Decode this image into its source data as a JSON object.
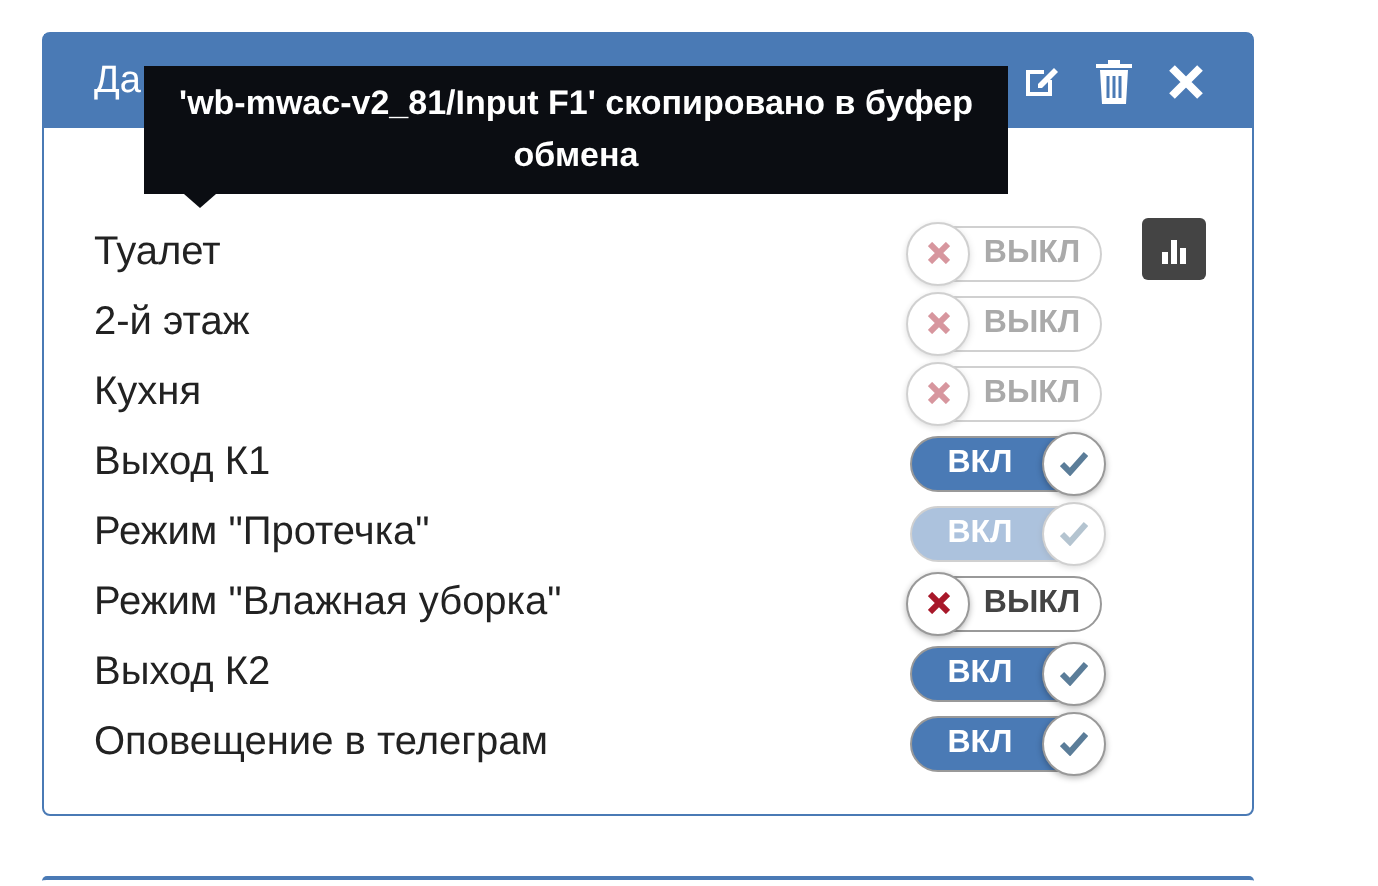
{
  "panel": {
    "title": "Да"
  },
  "tooltip": {
    "text": "'wb-mwac-v2_81/Input F1' скопировано в буфер обмена"
  },
  "rows": [
    {
      "label": "Туалет",
      "on": false,
      "disabled": true,
      "switch_text": "ВЫКЛ"
    },
    {
      "label": "2-й этаж",
      "on": false,
      "disabled": true,
      "switch_text": "ВЫКЛ"
    },
    {
      "label": "Кухня",
      "on": false,
      "disabled": true,
      "switch_text": "ВЫКЛ"
    },
    {
      "label": "Выход К1",
      "on": true,
      "disabled": false,
      "switch_text": "ВКЛ"
    },
    {
      "label": "Режим \"Протечка\"",
      "on": true,
      "disabled": true,
      "switch_text": "ВКЛ"
    },
    {
      "label": "Режим \"Влажная уборка\"",
      "on": false,
      "disabled": false,
      "switch_text": "ВЫКЛ"
    },
    {
      "label": "Выход К2",
      "on": true,
      "disabled": false,
      "switch_text": "ВКЛ"
    },
    {
      "label": "Оповещение в телеграм",
      "on": true,
      "disabled": false,
      "switch_text": "ВКЛ"
    }
  ]
}
